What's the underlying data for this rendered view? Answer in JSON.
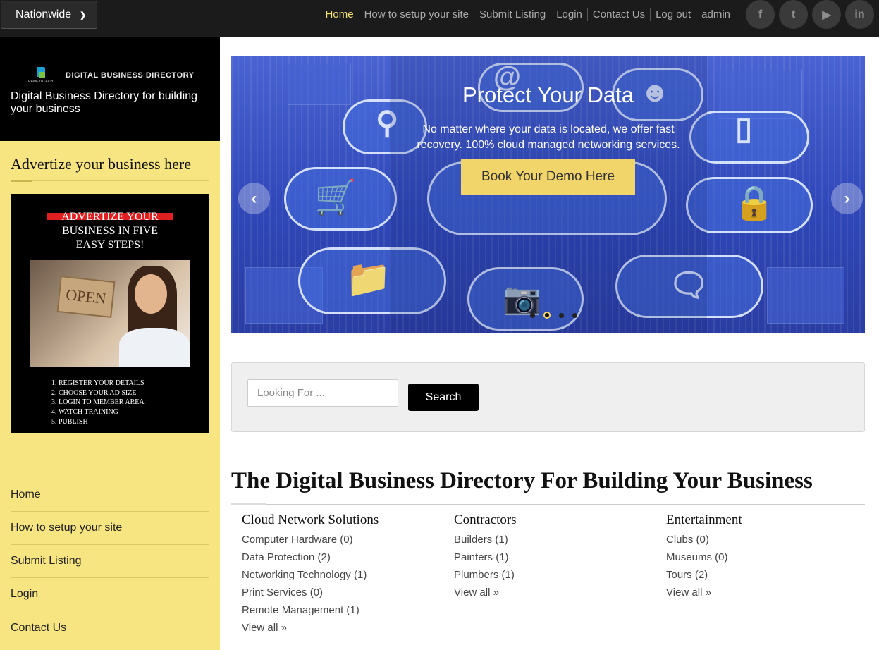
{
  "topbar": {
    "region": "Nationwide",
    "nav": [
      "Home",
      "How to setup your site",
      "Submit Listing",
      "Login",
      "Contact Us",
      "Log out",
      "admin"
    ],
    "socials": [
      "f",
      "t",
      "▶",
      "in"
    ]
  },
  "brand": {
    "logo_small_text": "RAMEYNTECH",
    "logo_name": "DIGITAL BUSINESS DIRECTORY",
    "tagline": "Digital Business Directory for building your business"
  },
  "sidebar": {
    "advertize_heading": "Advertize your business here",
    "ad": {
      "title_line1": "ADVERTIZE YOUR",
      "title_line2": "BUSINESS IN FIVE",
      "title_line3": "EASY STEPS!",
      "photo_sign": "OPEN",
      "steps": [
        "1. REGISTER YOUR DETAILS",
        "2. CHOOSE YOUR AD SIZE",
        "3. LOGIN TO MEMBER AREA",
        "4. WATCH TRAINING",
        "5. PUBLISH"
      ]
    },
    "menu": [
      "Home",
      "How to setup your site",
      "Submit Listing",
      "Login",
      "Contact Us"
    ]
  },
  "hero": {
    "title": "Protect Your Data",
    "text": "No matter where your data is located, we offer fast recovery. 100% cloud managed networking services.",
    "cta": "Book Your Demo Here",
    "prev": "‹",
    "next": "›",
    "slides": 4,
    "active_slide": 2
  },
  "search": {
    "placeholder": "Looking For ...",
    "button": "Search"
  },
  "directory": {
    "title": "The Digital Business Directory For Building Your Business",
    "columns": [
      {
        "heading": "Cloud Network Solutions",
        "items": [
          "Computer Hardware (0)",
          "Data Protection (2)",
          "Networking Technology (1)",
          "Print Services (0)",
          "Remote Management (1)",
          "View all »"
        ]
      },
      {
        "heading": "Contractors",
        "items": [
          "Builders (1)",
          "Painters (1)",
          "Plumbers (1)",
          "View all »"
        ]
      },
      {
        "heading": "Entertainment",
        "items": [
          "Clubs (0)",
          "Museums (0)",
          "Tours (2)",
          "View all »"
        ]
      }
    ]
  },
  "colors": {
    "sidebar_bg": "#f7e581",
    "topbar_bg": "#1b1b1b",
    "nav_active": "#f4e07a",
    "cta_bg": "#f2d56a"
  }
}
